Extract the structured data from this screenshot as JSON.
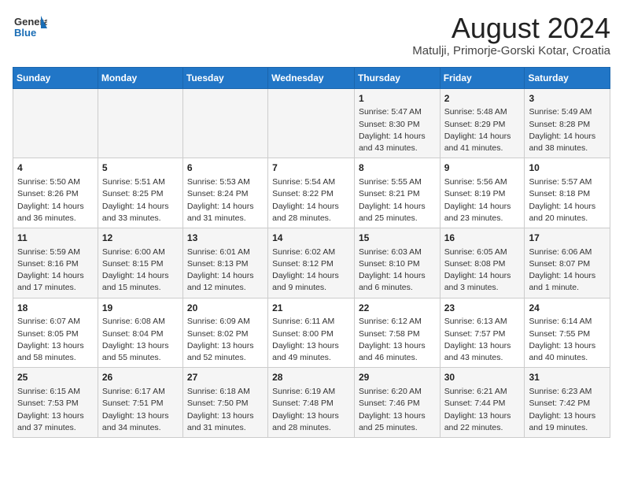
{
  "header": {
    "logo_line1": "General",
    "logo_line2": "Blue",
    "title": "August 2024",
    "subtitle": "Matulji, Primorje-Gorski Kotar, Croatia"
  },
  "weekdays": [
    "Sunday",
    "Monday",
    "Tuesday",
    "Wednesday",
    "Thursday",
    "Friday",
    "Saturday"
  ],
  "weeks": [
    [
      {
        "day": "",
        "detail": ""
      },
      {
        "day": "",
        "detail": ""
      },
      {
        "day": "",
        "detail": ""
      },
      {
        "day": "",
        "detail": ""
      },
      {
        "day": "1",
        "detail": "Sunrise: 5:47 AM\nSunset: 8:30 PM\nDaylight: 14 hours\nand 43 minutes."
      },
      {
        "day": "2",
        "detail": "Sunrise: 5:48 AM\nSunset: 8:29 PM\nDaylight: 14 hours\nand 41 minutes."
      },
      {
        "day": "3",
        "detail": "Sunrise: 5:49 AM\nSunset: 8:28 PM\nDaylight: 14 hours\nand 38 minutes."
      }
    ],
    [
      {
        "day": "4",
        "detail": "Sunrise: 5:50 AM\nSunset: 8:26 PM\nDaylight: 14 hours\nand 36 minutes."
      },
      {
        "day": "5",
        "detail": "Sunrise: 5:51 AM\nSunset: 8:25 PM\nDaylight: 14 hours\nand 33 minutes."
      },
      {
        "day": "6",
        "detail": "Sunrise: 5:53 AM\nSunset: 8:24 PM\nDaylight: 14 hours\nand 31 minutes."
      },
      {
        "day": "7",
        "detail": "Sunrise: 5:54 AM\nSunset: 8:22 PM\nDaylight: 14 hours\nand 28 minutes."
      },
      {
        "day": "8",
        "detail": "Sunrise: 5:55 AM\nSunset: 8:21 PM\nDaylight: 14 hours\nand 25 minutes."
      },
      {
        "day": "9",
        "detail": "Sunrise: 5:56 AM\nSunset: 8:19 PM\nDaylight: 14 hours\nand 23 minutes."
      },
      {
        "day": "10",
        "detail": "Sunrise: 5:57 AM\nSunset: 8:18 PM\nDaylight: 14 hours\nand 20 minutes."
      }
    ],
    [
      {
        "day": "11",
        "detail": "Sunrise: 5:59 AM\nSunset: 8:16 PM\nDaylight: 14 hours\nand 17 minutes."
      },
      {
        "day": "12",
        "detail": "Sunrise: 6:00 AM\nSunset: 8:15 PM\nDaylight: 14 hours\nand 15 minutes."
      },
      {
        "day": "13",
        "detail": "Sunrise: 6:01 AM\nSunset: 8:13 PM\nDaylight: 14 hours\nand 12 minutes."
      },
      {
        "day": "14",
        "detail": "Sunrise: 6:02 AM\nSunset: 8:12 PM\nDaylight: 14 hours\nand 9 minutes."
      },
      {
        "day": "15",
        "detail": "Sunrise: 6:03 AM\nSunset: 8:10 PM\nDaylight: 14 hours\nand 6 minutes."
      },
      {
        "day": "16",
        "detail": "Sunrise: 6:05 AM\nSunset: 8:08 PM\nDaylight: 14 hours\nand 3 minutes."
      },
      {
        "day": "17",
        "detail": "Sunrise: 6:06 AM\nSunset: 8:07 PM\nDaylight: 14 hours\nand 1 minute."
      }
    ],
    [
      {
        "day": "18",
        "detail": "Sunrise: 6:07 AM\nSunset: 8:05 PM\nDaylight: 13 hours\nand 58 minutes."
      },
      {
        "day": "19",
        "detail": "Sunrise: 6:08 AM\nSunset: 8:04 PM\nDaylight: 13 hours\nand 55 minutes."
      },
      {
        "day": "20",
        "detail": "Sunrise: 6:09 AM\nSunset: 8:02 PM\nDaylight: 13 hours\nand 52 minutes."
      },
      {
        "day": "21",
        "detail": "Sunrise: 6:11 AM\nSunset: 8:00 PM\nDaylight: 13 hours\nand 49 minutes."
      },
      {
        "day": "22",
        "detail": "Sunrise: 6:12 AM\nSunset: 7:58 PM\nDaylight: 13 hours\nand 46 minutes."
      },
      {
        "day": "23",
        "detail": "Sunrise: 6:13 AM\nSunset: 7:57 PM\nDaylight: 13 hours\nand 43 minutes."
      },
      {
        "day": "24",
        "detail": "Sunrise: 6:14 AM\nSunset: 7:55 PM\nDaylight: 13 hours\nand 40 minutes."
      }
    ],
    [
      {
        "day": "25",
        "detail": "Sunrise: 6:15 AM\nSunset: 7:53 PM\nDaylight: 13 hours\nand 37 minutes."
      },
      {
        "day": "26",
        "detail": "Sunrise: 6:17 AM\nSunset: 7:51 PM\nDaylight: 13 hours\nand 34 minutes."
      },
      {
        "day": "27",
        "detail": "Sunrise: 6:18 AM\nSunset: 7:50 PM\nDaylight: 13 hours\nand 31 minutes."
      },
      {
        "day": "28",
        "detail": "Sunrise: 6:19 AM\nSunset: 7:48 PM\nDaylight: 13 hours\nand 28 minutes."
      },
      {
        "day": "29",
        "detail": "Sunrise: 6:20 AM\nSunset: 7:46 PM\nDaylight: 13 hours\nand 25 minutes."
      },
      {
        "day": "30",
        "detail": "Sunrise: 6:21 AM\nSunset: 7:44 PM\nDaylight: 13 hours\nand 22 minutes."
      },
      {
        "day": "31",
        "detail": "Sunrise: 6:23 AM\nSunset: 7:42 PM\nDaylight: 13 hours\nand 19 minutes."
      }
    ]
  ]
}
